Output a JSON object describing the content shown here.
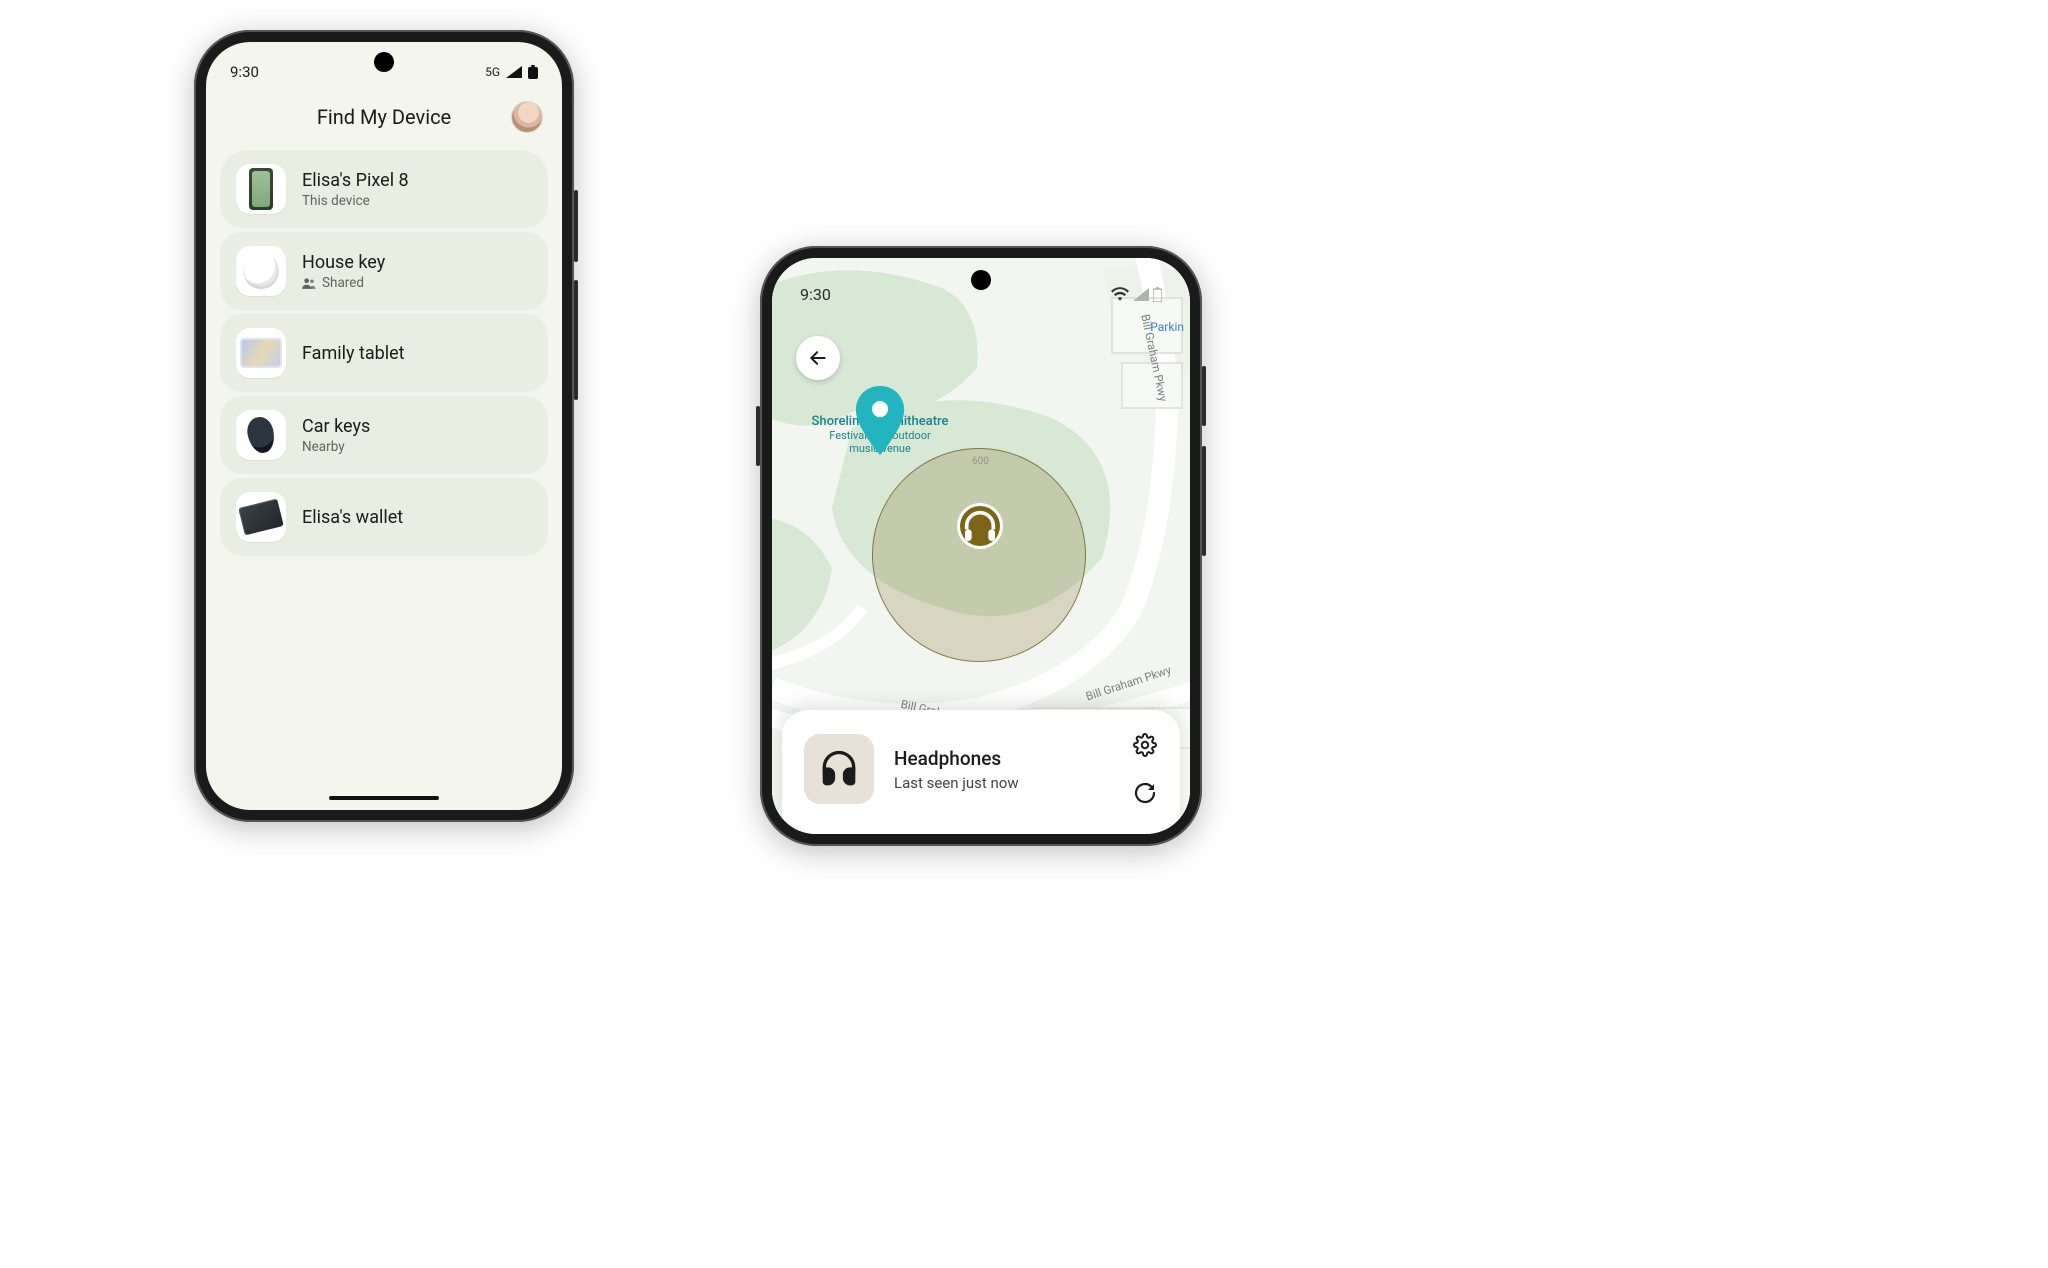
{
  "phone1": {
    "status": {
      "time": "9:30",
      "network": "5G"
    },
    "header": {
      "title": "Find My Device"
    },
    "devices": [
      {
        "name": "Elisa's Pixel 8",
        "sub": "This device",
        "icon": "phone"
      },
      {
        "name": "House key",
        "sub": "Shared",
        "icon": "tracker",
        "shared": true
      },
      {
        "name": "Family tablet",
        "sub": "",
        "icon": "tablet"
      },
      {
        "name": "Car keys",
        "sub": "Nearby",
        "icon": "fob"
      },
      {
        "name": "Elisa's wallet",
        "sub": "",
        "icon": "wallet"
      }
    ]
  },
  "phone2": {
    "status": {
      "time": "9:30"
    },
    "map": {
      "poi": {
        "title": "Shoreline Amphitheatre",
        "sub1": "Festival-size outdoor",
        "sub2": "music venue"
      },
      "road_label": "Bill Graham Pkwy",
      "road_label_2": "Bill Graham Pkwy",
      "parkin": "Parkin",
      "scale": "600"
    },
    "sheet": {
      "name": "Headphones",
      "sub": "Last seen just now"
    }
  }
}
